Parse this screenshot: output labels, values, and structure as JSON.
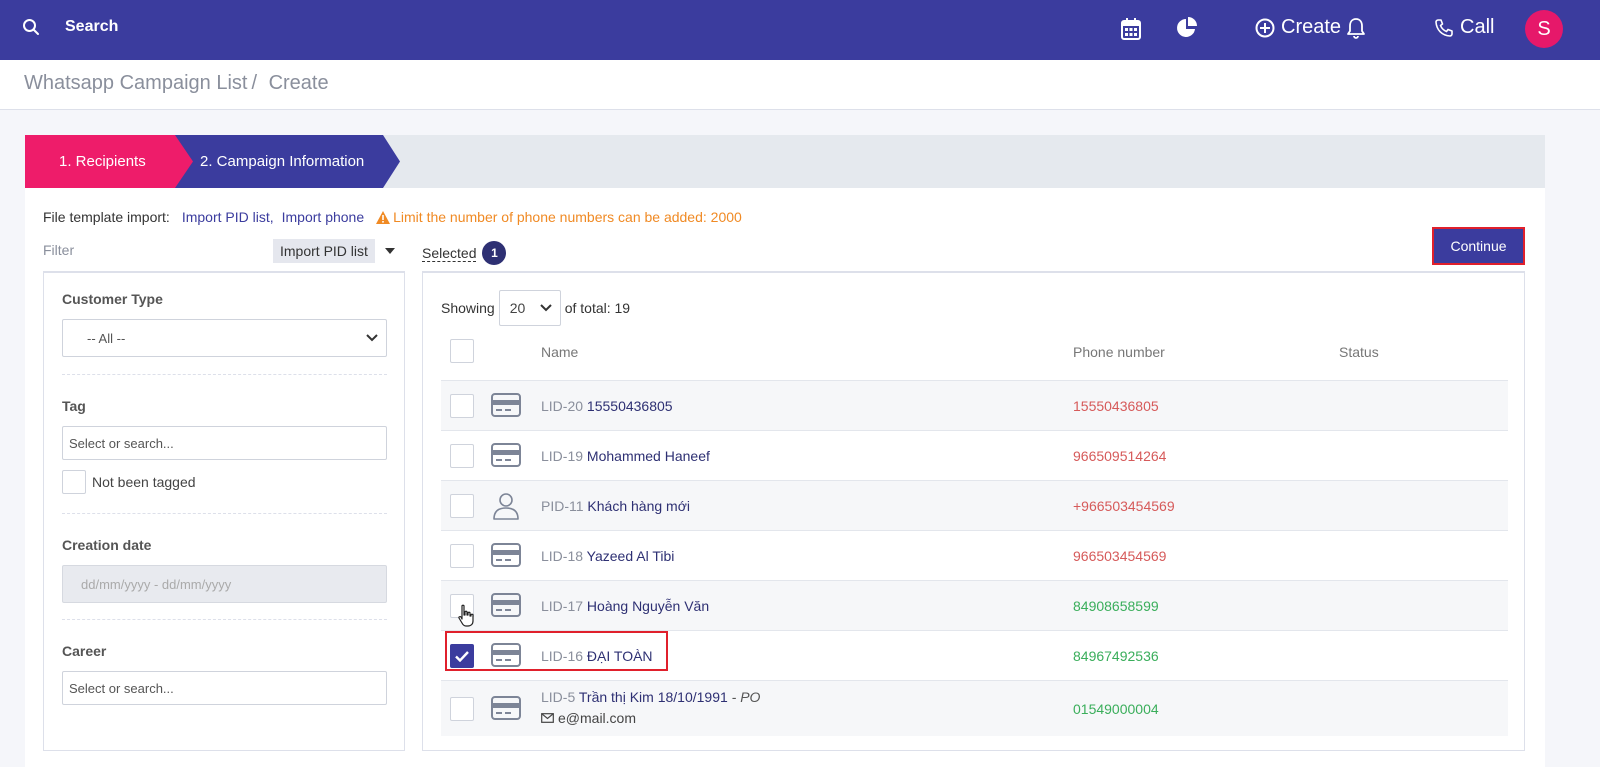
{
  "topbar": {
    "search_label": "Search",
    "create_label": "Create",
    "call_label": "Call",
    "avatar_initial": "S",
    "icons": [
      "search-icon",
      "calendar-icon",
      "pie-chart-icon",
      "plus-circle-icon",
      "bell-icon",
      "phone-icon"
    ]
  },
  "breadcrumb": {
    "parent": "Whatsapp Campaign List",
    "separator": "/",
    "current": "Create"
  },
  "steps": {
    "step1": "1. Recipients",
    "step2": "2. Campaign Information"
  },
  "template": {
    "label": "File template import:",
    "link1": "Import PID list,",
    "link2": "Import phone",
    "warning": "Limit the number of phone numbers can be added: 2000"
  },
  "filter": {
    "label": "Filter",
    "import_select": "Import PID list",
    "customer_type_label": "Customer Type",
    "customer_type_value": "-- All --",
    "tag_label": "Tag",
    "tag_placeholder": "Select or search...",
    "not_tagged_label": "Not been tagged",
    "creation_date_label": "Creation date",
    "creation_date_placeholder": "dd/mm/yyyy - dd/mm/yyyy",
    "career_label": "Career",
    "career_placeholder": "Select or search..."
  },
  "selected": {
    "label": "Selected",
    "count": "1"
  },
  "continue_label": "Continue",
  "table": {
    "showing_label": "Showing",
    "page_size": "20",
    "total_label": "of total: 19",
    "headers": {
      "name": "Name",
      "phone": "Phone number",
      "status": "Status"
    },
    "rows": [
      {
        "code": "LID-20",
        "name": "15550436805",
        "phone": "15550436805",
        "phone_color": "red",
        "icon": "id-card-icon",
        "checked": false
      },
      {
        "code": "LID-19",
        "name": "Mohammed Haneef",
        "phone": "966509514264",
        "phone_color": "red",
        "icon": "id-card-icon",
        "checked": false
      },
      {
        "code": "PID-11",
        "name": "Khách hàng mới",
        "phone": "+966503454569",
        "phone_color": "red",
        "icon": "user-icon",
        "checked": false
      },
      {
        "code": "LID-18",
        "name": "Yazeed Al Tibi",
        "phone": "966503454569",
        "phone_color": "red",
        "icon": "id-card-icon",
        "checked": false
      },
      {
        "code": "LID-17",
        "name": "Hoàng Nguyễn Văn",
        "phone": "84908658599",
        "phone_color": "green",
        "icon": "id-card-icon",
        "checked": false
      },
      {
        "code": "LID-16",
        "name": "ĐẠI TOÀN",
        "phone": "84967492536",
        "phone_color": "green",
        "icon": "id-card-icon",
        "checked": true
      },
      {
        "code": "LID-5",
        "name": "Trần thị Kim 18/10/1991",
        "tag": "- PO",
        "email": "e@mail.com",
        "phone": "01549000004",
        "phone_color": "green",
        "icon": "id-card-icon",
        "checked": false
      }
    ]
  },
  "colors": {
    "primary": "#3b3c9e",
    "accent": "#ee1c6a",
    "warning": "#f08a24",
    "phone_red": "#d65a5a",
    "phone_green": "#3aae5b"
  }
}
